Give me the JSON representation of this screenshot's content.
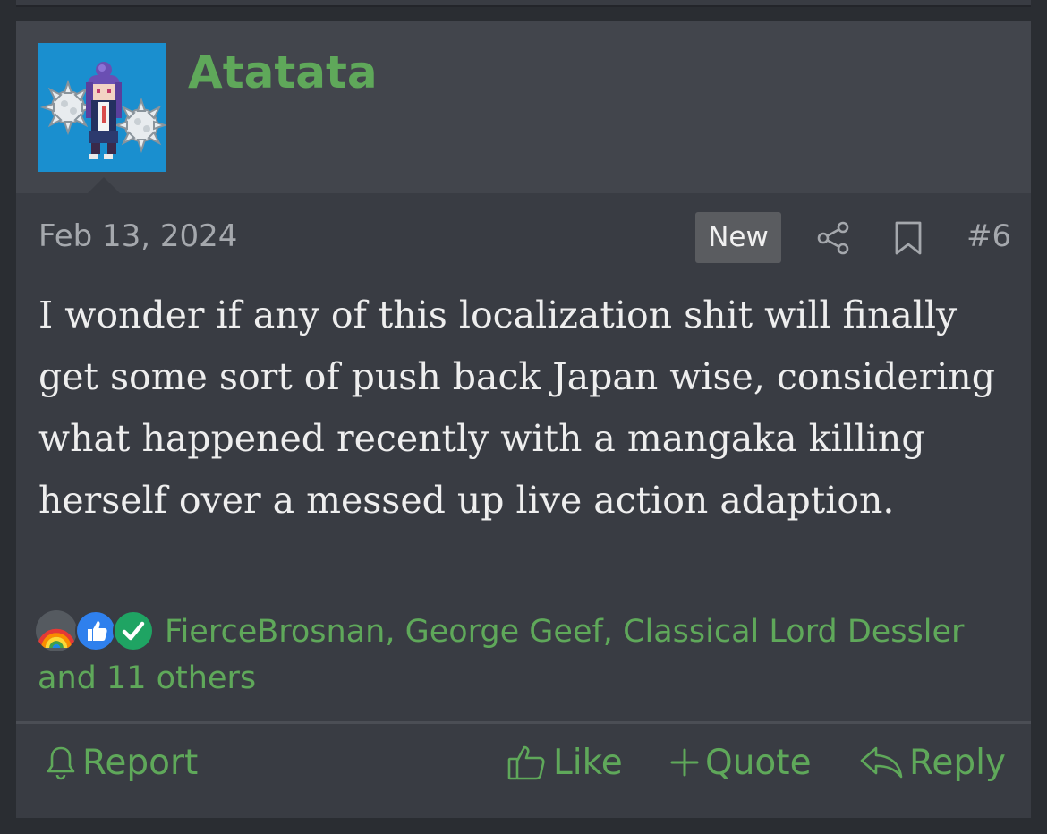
{
  "post": {
    "username": "Atatata",
    "date": "Feb 13, 2024",
    "badge": "New",
    "number": "#6",
    "body": "I wonder if any of this localization shit will finally get some sort of push back Japan wise, considering what happened recently with a mangaka killing herself over a messed up live action adaption."
  },
  "reactions": {
    "icons": [
      "rainbow-reaction-icon",
      "like-reaction-icon",
      "agree-checkmark-reaction-icon"
    ],
    "text": "FierceBrosnan, George Geef, Classical Lord Dessler and 11 others"
  },
  "actions": {
    "report": "Report",
    "like": "Like",
    "quote": "Quote",
    "reply": "Reply"
  },
  "icons": {
    "share": "share-icon",
    "bookmark": "bookmark-icon",
    "bell": "bell-icon",
    "thumbs_up": "thumbs-up-icon",
    "plus": "plus-icon",
    "reply_arrow": "reply-arrow-icon"
  },
  "colors": {
    "accent_green": "#5fa85a",
    "post_background": "#393c43",
    "header_background": "#42454c",
    "page_background": "#2a2d32",
    "avatar_background": "#1a8fcf",
    "badge_background": "#5a5c60",
    "muted_text": "#a5a8ad"
  }
}
